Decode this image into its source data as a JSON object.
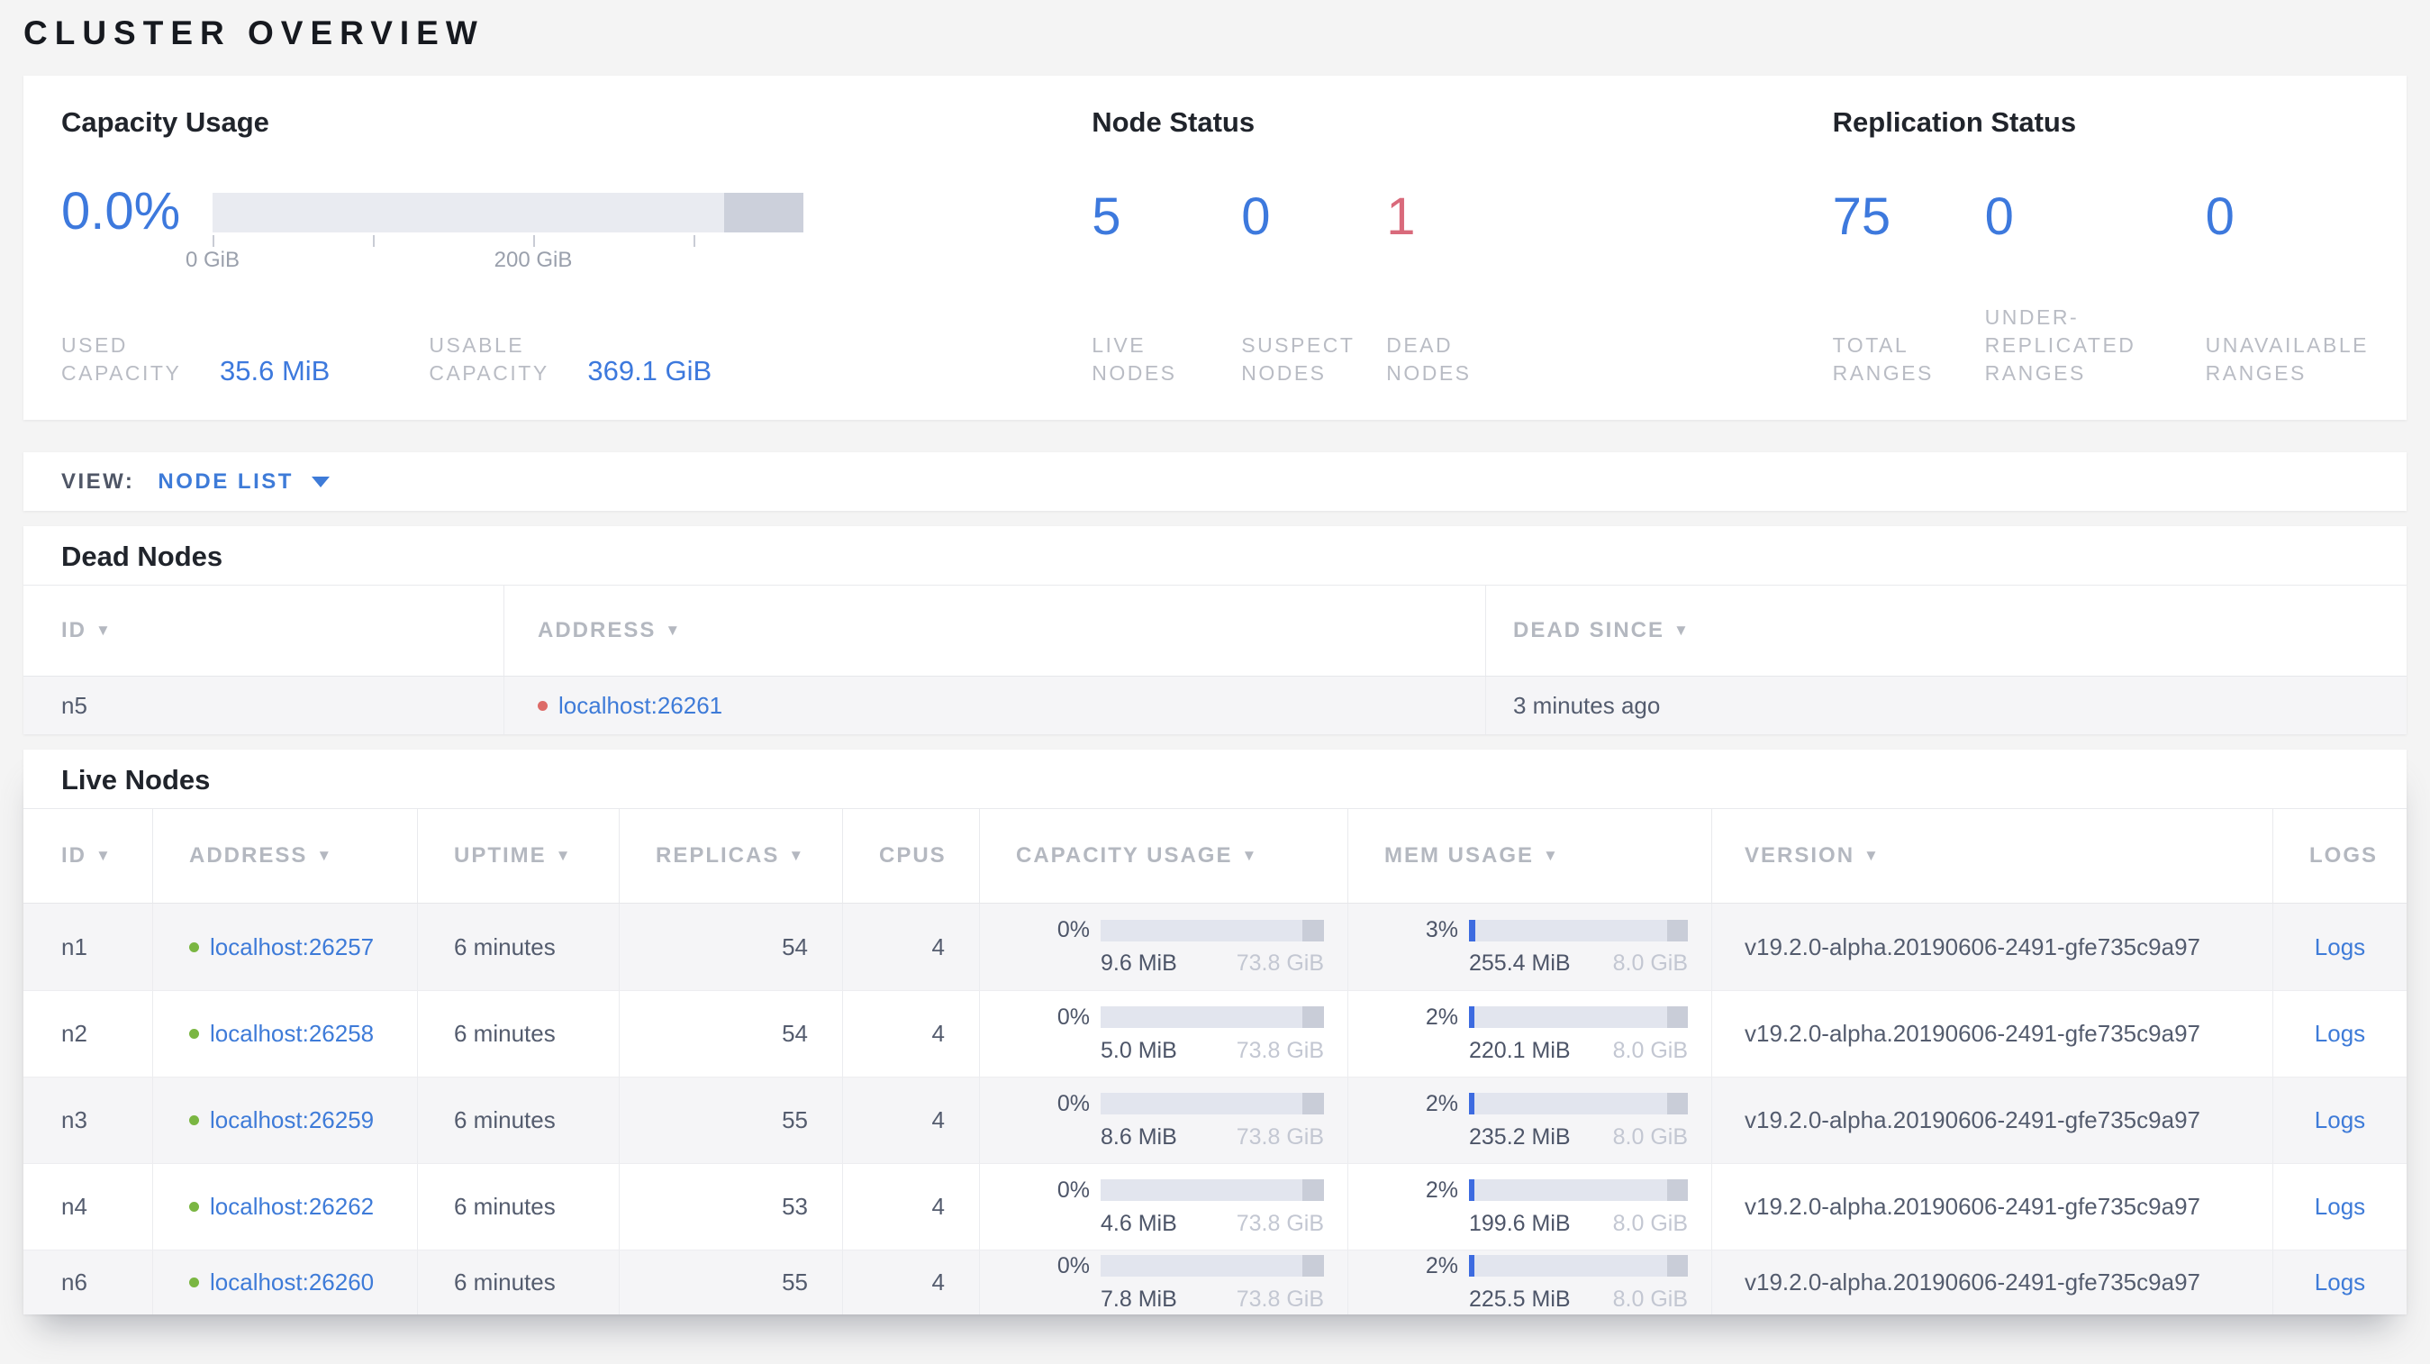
{
  "page": {
    "title": "CLUSTER OVERVIEW"
  },
  "colors": {
    "accent_blue": "#3e7bd8",
    "dead_red": "#d96a7b",
    "live_dot_green": "#7ab642",
    "dead_dot_red": "#dd6b68",
    "bar_track": "#e2e5ee",
    "bar_fill_blue": "#3d6be0",
    "bar_reserved_gray": "#c9cdd8"
  },
  "summary": {
    "capacity": {
      "title": "Capacity Usage",
      "percent": "0.0%",
      "tick_labels": [
        "0 GiB",
        "200 GiB"
      ],
      "stats": [
        {
          "label": "USED CAPACITY",
          "value": "35.6 MiB"
        },
        {
          "label": "USABLE CAPACITY",
          "value": "369.1 GiB"
        }
      ]
    },
    "node_status": {
      "title": "Node Status",
      "stats": [
        {
          "value": "5",
          "label": "LIVE NODES"
        },
        {
          "value": "0",
          "label": "SUSPECT NODES"
        },
        {
          "value": "1",
          "label": "DEAD NODES"
        }
      ]
    },
    "replication": {
      "title": "Replication Status",
      "stats": [
        {
          "value": "75",
          "label": "TOTAL RANGES"
        },
        {
          "value": "0",
          "label": "UNDER-REPLICATED RANGES"
        },
        {
          "value": "0",
          "label": "UNAVAILABLE RANGES"
        }
      ]
    }
  },
  "view_bar": {
    "label": "VIEW:",
    "selected": "NODE LIST"
  },
  "dead_nodes": {
    "title": "Dead Nodes",
    "columns": [
      {
        "label": "ID",
        "sortable": true
      },
      {
        "label": "ADDRESS",
        "sortable": true
      },
      {
        "label": "DEAD SINCE",
        "sortable": true
      }
    ],
    "rows": [
      {
        "id": "n5",
        "address": "localhost:26261",
        "dead_since": "3 minutes ago"
      }
    ]
  },
  "live_nodes": {
    "title": "Live Nodes",
    "columns": [
      {
        "label": "ID",
        "sortable": true
      },
      {
        "label": "ADDRESS",
        "sortable": true
      },
      {
        "label": "UPTIME",
        "sortable": true
      },
      {
        "label": "REPLICAS",
        "sortable": true
      },
      {
        "label": "CPUS",
        "sortable": false
      },
      {
        "label": "CAPACITY USAGE",
        "sortable": true
      },
      {
        "label": "MEM USAGE",
        "sortable": true
      },
      {
        "label": "VERSION",
        "sortable": true
      },
      {
        "label": "LOGS",
        "sortable": false
      }
    ],
    "logs_label": "Logs",
    "rows": [
      {
        "id": "n1",
        "address": "localhost:26257",
        "uptime": "6 minutes",
        "replicas": "54",
        "cpus": "4",
        "capacity": {
          "percent": "0%",
          "fill_pct": 0,
          "used": "9.6 MiB",
          "total": "73.8 GiB"
        },
        "mem": {
          "percent": "3%",
          "fill_pct": 3,
          "used": "255.4 MiB",
          "total": "8.0 GiB"
        },
        "version": "v19.2.0-alpha.20190606-2491-gfe735c9a97"
      },
      {
        "id": "n2",
        "address": "localhost:26258",
        "uptime": "6 minutes",
        "replicas": "54",
        "cpus": "4",
        "capacity": {
          "percent": "0%",
          "fill_pct": 0,
          "used": "5.0 MiB",
          "total": "73.8 GiB"
        },
        "mem": {
          "percent": "2%",
          "fill_pct": 2.3,
          "used": "220.1 MiB",
          "total": "8.0 GiB"
        },
        "version": "v19.2.0-alpha.20190606-2491-gfe735c9a97"
      },
      {
        "id": "n3",
        "address": "localhost:26259",
        "uptime": "6 minutes",
        "replicas": "55",
        "cpus": "4",
        "capacity": {
          "percent": "0%",
          "fill_pct": 0,
          "used": "8.6 MiB",
          "total": "73.8 GiB"
        },
        "mem": {
          "percent": "2%",
          "fill_pct": 2.3,
          "used": "235.2 MiB",
          "total": "8.0 GiB"
        },
        "version": "v19.2.0-alpha.20190606-2491-gfe735c9a97"
      },
      {
        "id": "n4",
        "address": "localhost:26262",
        "uptime": "6 minutes",
        "replicas": "53",
        "cpus": "4",
        "capacity": {
          "percent": "0%",
          "fill_pct": 0,
          "used": "4.6 MiB",
          "total": "73.8 GiB"
        },
        "mem": {
          "percent": "2%",
          "fill_pct": 2.3,
          "used": "199.6 MiB",
          "total": "8.0 GiB"
        },
        "version": "v19.2.0-alpha.20190606-2491-gfe735c9a97"
      },
      {
        "id": "n6",
        "address": "localhost:26260",
        "uptime": "6 minutes",
        "replicas": "55",
        "cpus": "4",
        "capacity": {
          "percent": "0%",
          "fill_pct": 0,
          "used": "7.8 MiB",
          "total": "73.8 GiB"
        },
        "mem": {
          "percent": "2%",
          "fill_pct": 2.3,
          "used": "225.5 MiB",
          "total": "8.0 GiB"
        },
        "version": "v19.2.0-alpha.20190606-2491-gfe735c9a97"
      }
    ]
  }
}
